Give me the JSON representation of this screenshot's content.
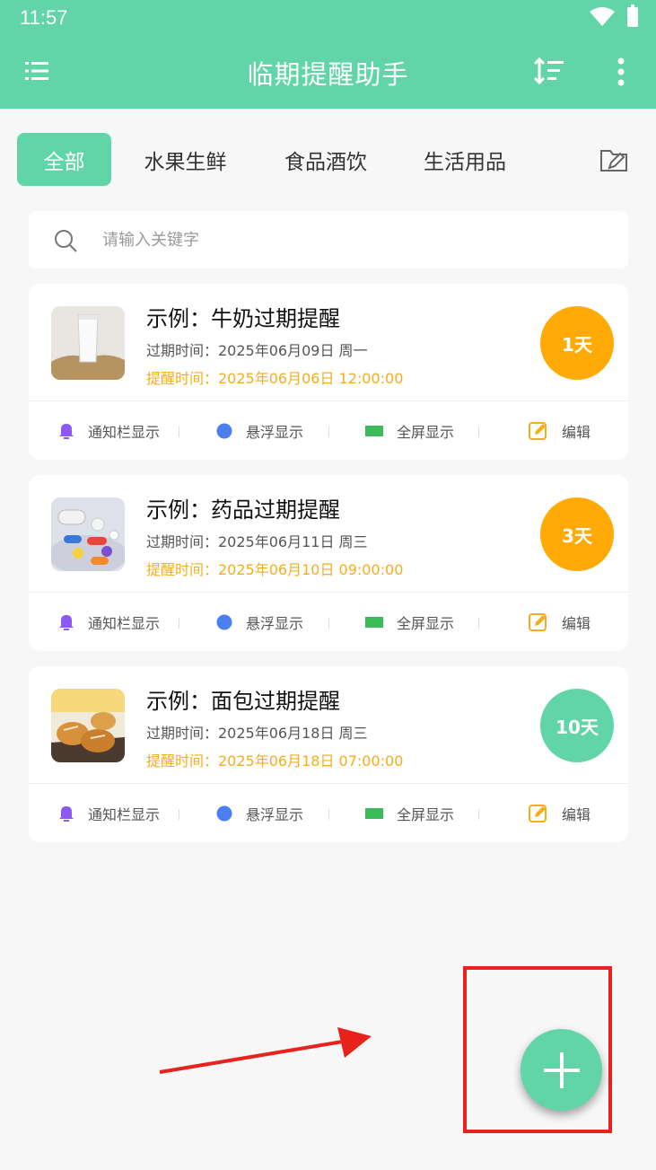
{
  "status_bar": {
    "time": "11:57"
  },
  "app_bar": {
    "title": "临期提醒助手"
  },
  "tabs": [
    {
      "label": "全部",
      "active": true
    },
    {
      "label": "水果生鲜",
      "active": false
    },
    {
      "label": "食品酒饮",
      "active": false
    },
    {
      "label": "生活用品",
      "active": false
    }
  ],
  "search": {
    "placeholder": "请输入关键字"
  },
  "items": [
    {
      "title": "示例：牛奶过期提醒",
      "expire": "过期时间：2025年06月09日   周一",
      "remind": "提醒时间：2025年06月06日 12:00:00",
      "days_left": "1天",
      "badge_color": "#ffaa06"
    },
    {
      "title": "示例：药品过期提醒",
      "expire": "过期时间：2025年06月11日   周三",
      "remind": "提醒时间：2025年06月10日 09:00:00",
      "days_left": "3天",
      "badge_color": "#ffaa06"
    },
    {
      "title": "示例：面包过期提醒",
      "expire": "过期时间：2025年06月18日   周三",
      "remind": "提醒时间：2025年06月18日 07:00:00",
      "days_left": "10天",
      "badge_color": "#62d5a8"
    }
  ],
  "actions": {
    "notify": "通知栏显示",
    "float": "悬浮显示",
    "fullscreen": "全屏显示",
    "edit": "编辑"
  },
  "colors": {
    "primary": "#62d5a8",
    "warning": "#ffaa06",
    "remind_text": "#f3ad1d",
    "annotation": "#e8231e"
  }
}
